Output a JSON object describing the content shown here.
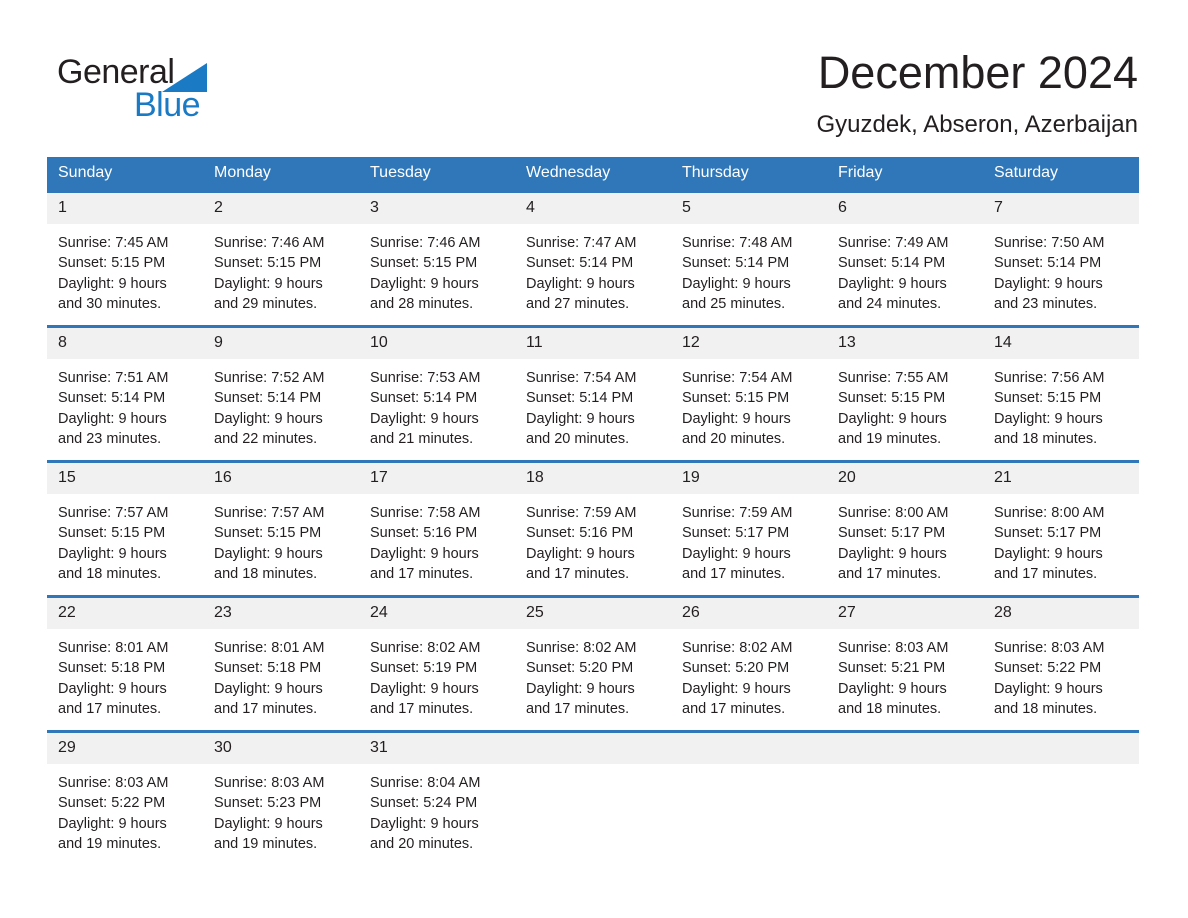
{
  "brand": {
    "name_part1": "General",
    "name_part2": "Blue",
    "triangle_color": "#1a7ac4",
    "icon": "general-blue-logo-triangle"
  },
  "header": {
    "title": "December 2024",
    "location": "Gyuzdek, Abseron, Azerbaijan"
  },
  "theme": {
    "header_blue": "#2f77b8",
    "daynum_band": "#f1f1f1",
    "text": "#231f20",
    "brand_blue": "#1a7ac4"
  },
  "calendar": {
    "weekday_headers": [
      "Sunday",
      "Monday",
      "Tuesday",
      "Wednesday",
      "Thursday",
      "Friday",
      "Saturday"
    ],
    "weeks": [
      [
        {
          "day": "1",
          "sunrise": "Sunrise: 7:45 AM",
          "sunset": "Sunset: 5:15 PM",
          "daylight": "Daylight: 9 hours and 30 minutes."
        },
        {
          "day": "2",
          "sunrise": "Sunrise: 7:46 AM",
          "sunset": "Sunset: 5:15 PM",
          "daylight": "Daylight: 9 hours and 29 minutes."
        },
        {
          "day": "3",
          "sunrise": "Sunrise: 7:46 AM",
          "sunset": "Sunset: 5:15 PM",
          "daylight": "Daylight: 9 hours and 28 minutes."
        },
        {
          "day": "4",
          "sunrise": "Sunrise: 7:47 AM",
          "sunset": "Sunset: 5:14 PM",
          "daylight": "Daylight: 9 hours and 27 minutes."
        },
        {
          "day": "5",
          "sunrise": "Sunrise: 7:48 AM",
          "sunset": "Sunset: 5:14 PM",
          "daylight": "Daylight: 9 hours and 25 minutes."
        },
        {
          "day": "6",
          "sunrise": "Sunrise: 7:49 AM",
          "sunset": "Sunset: 5:14 PM",
          "daylight": "Daylight: 9 hours and 24 minutes."
        },
        {
          "day": "7",
          "sunrise": "Sunrise: 7:50 AM",
          "sunset": "Sunset: 5:14 PM",
          "daylight": "Daylight: 9 hours and 23 minutes."
        }
      ],
      [
        {
          "day": "8",
          "sunrise": "Sunrise: 7:51 AM",
          "sunset": "Sunset: 5:14 PM",
          "daylight": "Daylight: 9 hours and 23 minutes."
        },
        {
          "day": "9",
          "sunrise": "Sunrise: 7:52 AM",
          "sunset": "Sunset: 5:14 PM",
          "daylight": "Daylight: 9 hours and 22 minutes."
        },
        {
          "day": "10",
          "sunrise": "Sunrise: 7:53 AM",
          "sunset": "Sunset: 5:14 PM",
          "daylight": "Daylight: 9 hours and 21 minutes."
        },
        {
          "day": "11",
          "sunrise": "Sunrise: 7:54 AM",
          "sunset": "Sunset: 5:14 PM",
          "daylight": "Daylight: 9 hours and 20 minutes."
        },
        {
          "day": "12",
          "sunrise": "Sunrise: 7:54 AM",
          "sunset": "Sunset: 5:15 PM",
          "daylight": "Daylight: 9 hours and 20 minutes."
        },
        {
          "day": "13",
          "sunrise": "Sunrise: 7:55 AM",
          "sunset": "Sunset: 5:15 PM",
          "daylight": "Daylight: 9 hours and 19 minutes."
        },
        {
          "day": "14",
          "sunrise": "Sunrise: 7:56 AM",
          "sunset": "Sunset: 5:15 PM",
          "daylight": "Daylight: 9 hours and 18 minutes."
        }
      ],
      [
        {
          "day": "15",
          "sunrise": "Sunrise: 7:57 AM",
          "sunset": "Sunset: 5:15 PM",
          "daylight": "Daylight: 9 hours and 18 minutes."
        },
        {
          "day": "16",
          "sunrise": "Sunrise: 7:57 AM",
          "sunset": "Sunset: 5:15 PM",
          "daylight": "Daylight: 9 hours and 18 minutes."
        },
        {
          "day": "17",
          "sunrise": "Sunrise: 7:58 AM",
          "sunset": "Sunset: 5:16 PM",
          "daylight": "Daylight: 9 hours and 17 minutes."
        },
        {
          "day": "18",
          "sunrise": "Sunrise: 7:59 AM",
          "sunset": "Sunset: 5:16 PM",
          "daylight": "Daylight: 9 hours and 17 minutes."
        },
        {
          "day": "19",
          "sunrise": "Sunrise: 7:59 AM",
          "sunset": "Sunset: 5:17 PM",
          "daylight": "Daylight: 9 hours and 17 minutes."
        },
        {
          "day": "20",
          "sunrise": "Sunrise: 8:00 AM",
          "sunset": "Sunset: 5:17 PM",
          "daylight": "Daylight: 9 hours and 17 minutes."
        },
        {
          "day": "21",
          "sunrise": "Sunrise: 8:00 AM",
          "sunset": "Sunset: 5:17 PM",
          "daylight": "Daylight: 9 hours and 17 minutes."
        }
      ],
      [
        {
          "day": "22",
          "sunrise": "Sunrise: 8:01 AM",
          "sunset": "Sunset: 5:18 PM",
          "daylight": "Daylight: 9 hours and 17 minutes."
        },
        {
          "day": "23",
          "sunrise": "Sunrise: 8:01 AM",
          "sunset": "Sunset: 5:18 PM",
          "daylight": "Daylight: 9 hours and 17 minutes."
        },
        {
          "day": "24",
          "sunrise": "Sunrise: 8:02 AM",
          "sunset": "Sunset: 5:19 PM",
          "daylight": "Daylight: 9 hours and 17 minutes."
        },
        {
          "day": "25",
          "sunrise": "Sunrise: 8:02 AM",
          "sunset": "Sunset: 5:20 PM",
          "daylight": "Daylight: 9 hours and 17 minutes."
        },
        {
          "day": "26",
          "sunrise": "Sunrise: 8:02 AM",
          "sunset": "Sunset: 5:20 PM",
          "daylight": "Daylight: 9 hours and 17 minutes."
        },
        {
          "day": "27",
          "sunrise": "Sunrise: 8:03 AM",
          "sunset": "Sunset: 5:21 PM",
          "daylight": "Daylight: 9 hours and 18 minutes."
        },
        {
          "day": "28",
          "sunrise": "Sunrise: 8:03 AM",
          "sunset": "Sunset: 5:22 PM",
          "daylight": "Daylight: 9 hours and 18 minutes."
        }
      ],
      [
        {
          "day": "29",
          "sunrise": "Sunrise: 8:03 AM",
          "sunset": "Sunset: 5:22 PM",
          "daylight": "Daylight: 9 hours and 19 minutes."
        },
        {
          "day": "30",
          "sunrise": "Sunrise: 8:03 AM",
          "sunset": "Sunset: 5:23 PM",
          "daylight": "Daylight: 9 hours and 19 minutes."
        },
        {
          "day": "31",
          "sunrise": "Sunrise: 8:04 AM",
          "sunset": "Sunset: 5:24 PM",
          "daylight": "Daylight: 9 hours and 20 minutes."
        },
        {
          "day": "",
          "sunrise": "",
          "sunset": "",
          "daylight": ""
        },
        {
          "day": "",
          "sunrise": "",
          "sunset": "",
          "daylight": ""
        },
        {
          "day": "",
          "sunrise": "",
          "sunset": "",
          "daylight": ""
        },
        {
          "day": "",
          "sunrise": "",
          "sunset": "",
          "daylight": ""
        }
      ]
    ]
  }
}
